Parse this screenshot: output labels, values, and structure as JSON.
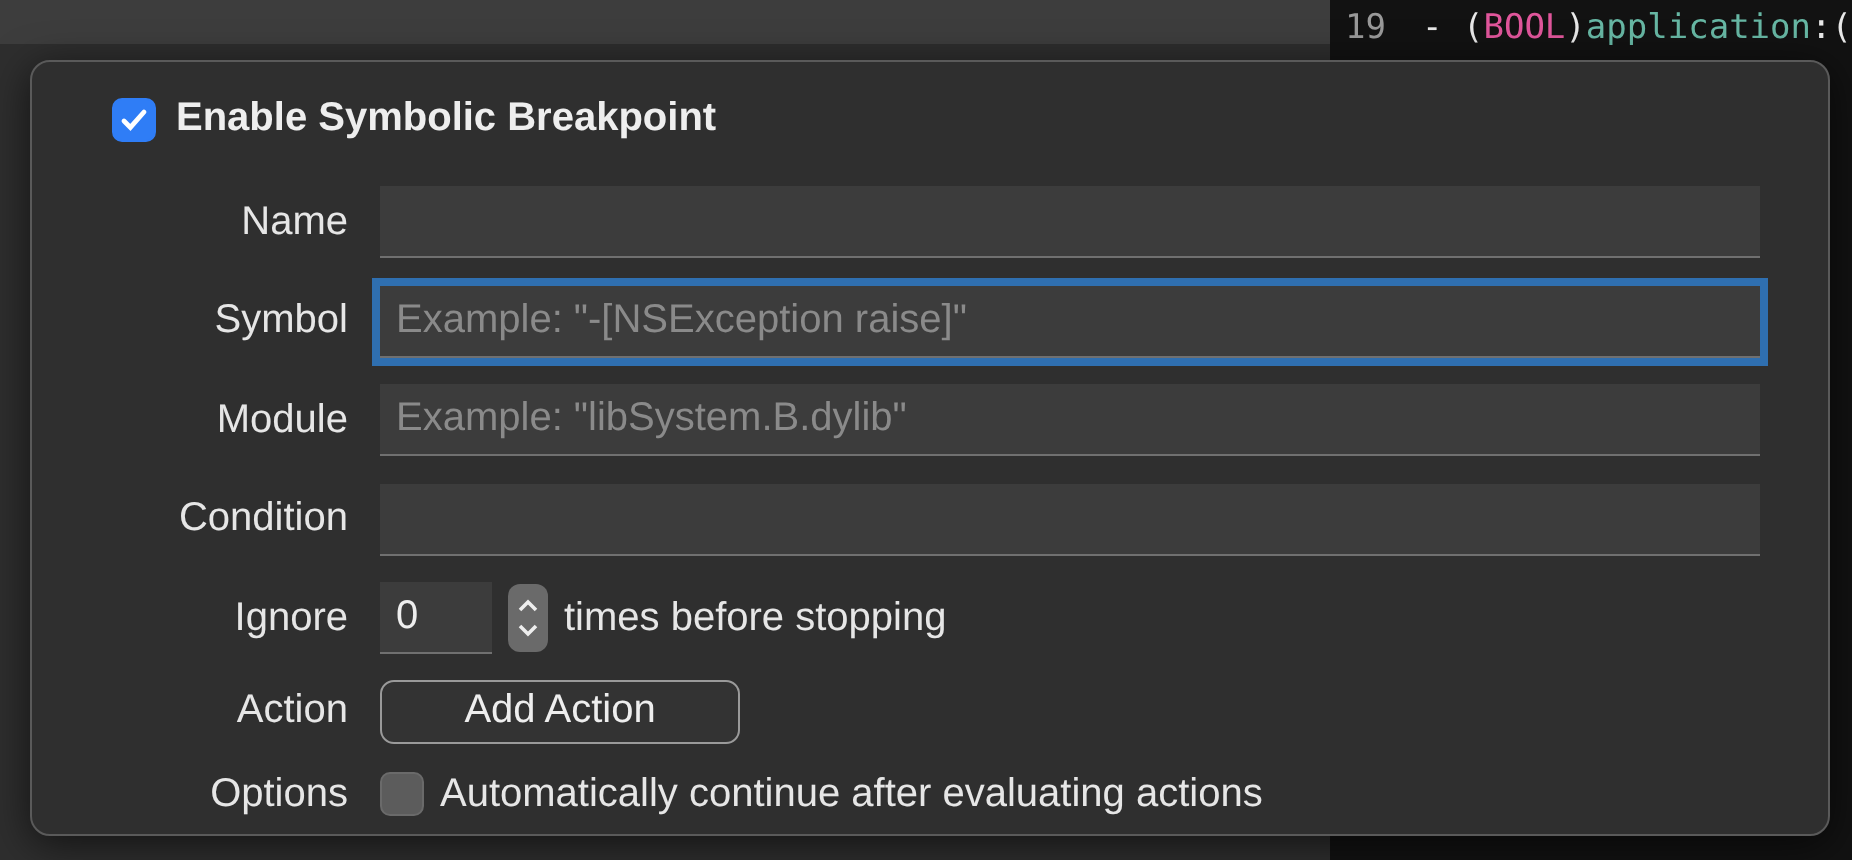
{
  "editor": {
    "line_number": "19",
    "tokens": [
      {
        "text": "- (",
        "color": "#e8e8e8"
      },
      {
        "text": "BOOL",
        "color": "#e0569b"
      },
      {
        "text": ")",
        "color": "#e8e8e8"
      },
      {
        "text": "application",
        "color": "#67b7a4"
      },
      {
        "text": ":(",
        "color": "#e8e8e8"
      }
    ]
  },
  "popover": {
    "enable": {
      "label": "Enable Symbolic Breakpoint",
      "checked": true
    },
    "fields": [
      {
        "label": "Name",
        "focused": false
      },
      {
        "label": "Symbol",
        "placeholder": "Example: \"-[NSException raise]\"",
        "focused": true
      },
      {
        "label": "Module",
        "placeholder": "Example: \"libSystem.B.dylib\"",
        "focused": false
      },
      {
        "label": "Condition",
        "focused": false
      }
    ],
    "ignore": {
      "label": "Ignore",
      "value": "0",
      "suffix": "times before stopping"
    },
    "action": {
      "label": "Action",
      "button": "Add Action"
    },
    "options": {
      "label": "Options",
      "checkbox": {
        "label": "Automatically continue after evaluating actions",
        "checked": false
      }
    }
  }
}
